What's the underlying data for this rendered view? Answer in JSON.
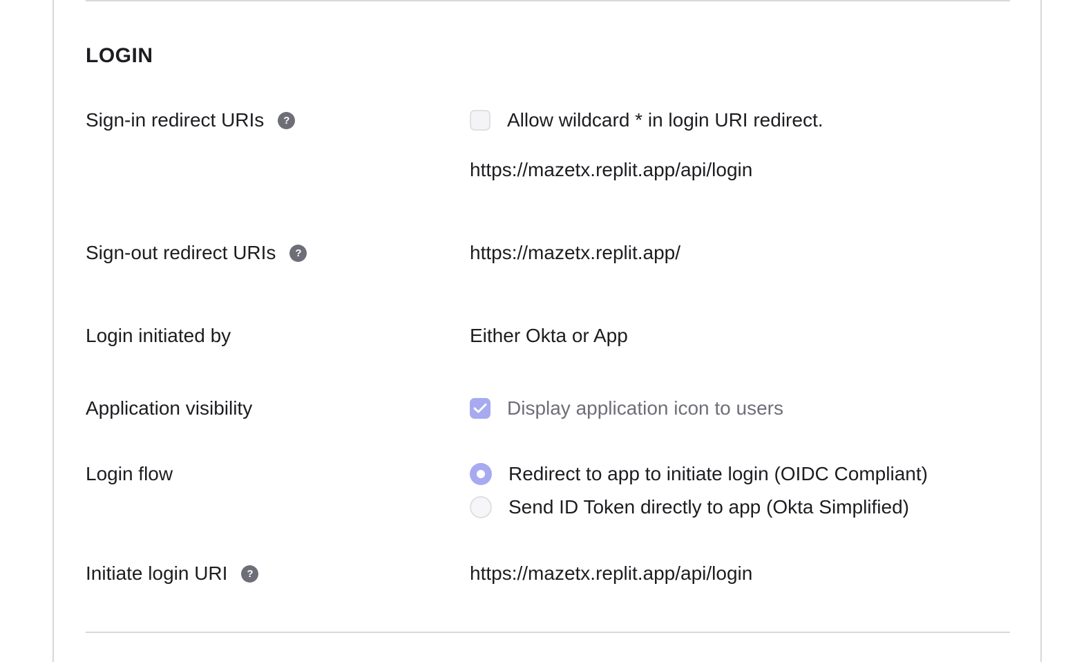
{
  "section": {
    "title": "LOGIN"
  },
  "rows": {
    "signin_redirect": {
      "label": "Sign-in redirect URIs",
      "help_icon": "question-circle-icon",
      "wildcard_option": {
        "label": "Allow wildcard * in login URI redirect.",
        "checked": false
      },
      "uri": "https://mazetx.replit.app/api/login"
    },
    "signout_redirect": {
      "label": "Sign-out redirect URIs",
      "help_icon": "question-circle-icon",
      "uri": "https://mazetx.replit.app/"
    },
    "login_initiated_by": {
      "label": "Login initiated by",
      "value": "Either Okta or App"
    },
    "app_visibility": {
      "label": "Application visibility",
      "option": {
        "label": "Display application icon to users",
        "checked": true
      }
    },
    "login_flow": {
      "label": "Login flow",
      "options": [
        {
          "label": "Redirect to app to initiate login (OIDC Compliant)",
          "selected": true
        },
        {
          "label": "Send ID Token directly to app (Okta Simplified)",
          "selected": false
        }
      ]
    },
    "initiate_login_uri": {
      "label": "Initiate login URI",
      "help_icon": "question-circle-icon",
      "value": "https://mazetx.replit.app/api/login"
    }
  },
  "colors": {
    "accent": "#a7aaf0",
    "text": "#1d1d21",
    "muted_text": "#6e6e78",
    "divider": "#d7d7dc",
    "help_icon_bg": "#6e6e78"
  }
}
